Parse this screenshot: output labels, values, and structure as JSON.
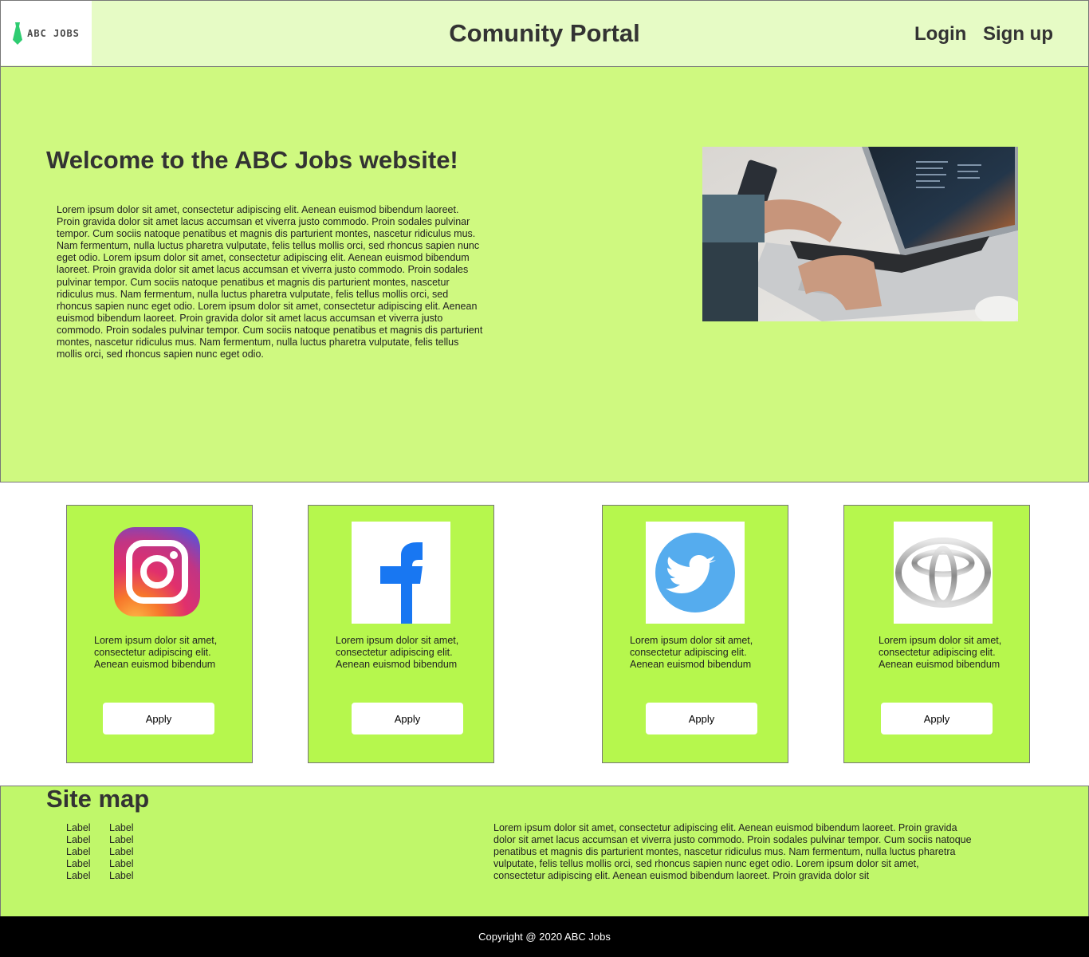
{
  "header": {
    "logo_text": "ABC JOBS",
    "title": "Comunity Portal",
    "nav": {
      "login": "Login",
      "signup": "Sign up"
    }
  },
  "hero": {
    "title": "Welcome to the ABC Jobs website!",
    "text": "Lorem ipsum dolor sit amet, consectetur adipiscing elit. Aenean euismod bibendum laoreet. Proin gravida dolor sit amet lacus accumsan et viverra justo commodo. Proin sodales pulvinar tempor. Cum sociis natoque penatibus et magnis dis parturient montes, nascetur ridiculus mus. Nam fermentum, nulla luctus pharetra vulputate, felis tellus mollis orci, sed rhoncus sapien nunc eget odio. Lorem ipsum dolor sit amet, consectetur adipiscing elit. Aenean euismod bibendum laoreet. Proin gravida dolor sit amet lacus accumsan et viverra justo commodo. Proin sodales pulvinar tempor. Cum sociis natoque penatibus et magnis dis parturient montes, nascetur ridiculus mus. Nam fermentum, nulla luctus pharetra vulputate, felis tellus mollis orci, sed rhoncus sapien nunc eget odio. Lorem ipsum dolor sit amet, consectetur adipiscing elit. Aenean euismod bibendum laoreet. Proin gravida dolor sit amet lacus accumsan et viverra justo commodo. Proin sodales pulvinar tempor. Cum sociis natoque penatibus et magnis dis parturient montes, nascetur ridiculus mus. Nam fermentum, nulla luctus pharetra vulputate, felis tellus mollis orci, sed rhoncus sapien nunc eget odio.",
    "image_icon": "laptop-photo"
  },
  "cards": [
    {
      "icon": "instagram-icon",
      "text": "Lorem ipsum dolor sit amet, consectetur adipiscing elit. Aenean euismod bibendum",
      "button": "Apply"
    },
    {
      "icon": "facebook-icon",
      "text": "Lorem ipsum dolor sit amet, consectetur adipiscing elit. Aenean euismod bibendum",
      "button": "Apply"
    },
    {
      "icon": "twitter-icon",
      "text": "Lorem ipsum dolor sit amet, consectetur adipiscing elit. Aenean euismod bibendum",
      "button": "Apply"
    },
    {
      "icon": "toyota-icon",
      "text": "Lorem ipsum dolor sit amet, consectetur adipiscing elit. Aenean euismod bibendum",
      "button": "Apply"
    }
  ],
  "sitemap": {
    "title": "Site map",
    "labels_col1": [
      "Label",
      "Label",
      "Label",
      "Label",
      "Label"
    ],
    "labels_col2": [
      "Label",
      "Label",
      "Label",
      "Label",
      "Label"
    ],
    "text": "Lorem ipsum dolor sit amet, consectetur adipiscing elit. Aenean euismod bibendum laoreet. Proin gravida dolor sit amet lacus accumsan et viverra justo commodo. Proin sodales pulvinar tempor. Cum sociis natoque penatibus et magnis dis parturient montes, nascetur ridiculus mus. Nam fermentum, nulla luctus pharetra vulputate, felis tellus mollis orci, sed rhoncus sapien nunc eget odio. Lorem ipsum dolor sit amet, consectetur adipiscing elit. Aenean euismod bibendum laoreet. Proin gravida dolor sit"
  },
  "footer": {
    "copyright": "Copyright @ 2020 ABC Jobs"
  },
  "colors": {
    "header_bg": "#e6fbc5",
    "hero_bg": "#cff980",
    "card_bg": "#b6f74d",
    "sitemap_bg": "#c0f76a",
    "footer_bg": "#000000"
  }
}
